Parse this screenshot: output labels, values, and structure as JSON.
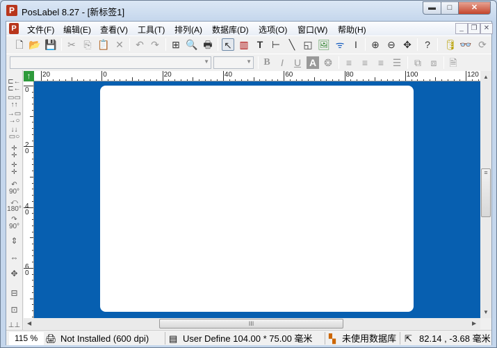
{
  "window": {
    "title": "PosLabel 8.27 - [新标签1]",
    "app_icon": "P"
  },
  "menu": [
    "文件(F)",
    "编辑(E)",
    "查看(V)",
    "工具(T)",
    "排列(A)",
    "数据库(D)",
    "选项(O)",
    "窗口(W)",
    "帮助(H)"
  ],
  "format": {
    "font": "",
    "size": ""
  },
  "ruler": {
    "h_labels": [
      "20",
      "0",
      "20",
      "40",
      "60",
      "80",
      "100",
      "120"
    ],
    "v_labels": [
      "0",
      "2\n0",
      "4\n0",
      "6\n0"
    ]
  },
  "left_tools": {
    "rot90": "90°",
    "rot180": "180°",
    "rot90b": "90°"
  },
  "status": {
    "zoom": "115 %",
    "printer": "Not Installed (600 dpi)",
    "page": "User Define  104.00 * 75.00 毫米",
    "database": "未使用数据库",
    "coords": "82.14 , -3.68 毫米"
  },
  "colors": {
    "canvas": "#075fb0",
    "label": "#ffffff"
  }
}
